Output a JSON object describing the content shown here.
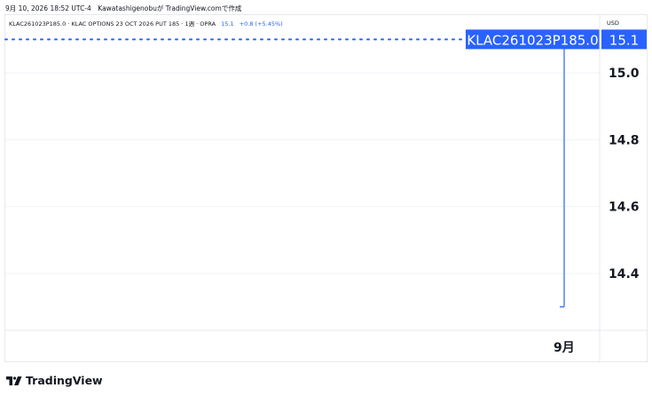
{
  "caption": "9月 10, 2026 18:52 UTC-4　Kawatashigenobuが TradingView.comで作成",
  "legend": {
    "title": "KLAC261023P185.0 · KLAC OPTIONS 23 OCT 2026 PUT 185 · 1週 · OPRA",
    "value": "15.1",
    "change": "+0.8 (+5.45%)"
  },
  "currency": "USD",
  "brand": {
    "name": "TradingView",
    "icon": "tradingview-logo-icon"
  },
  "colors": {
    "line": "#2962ff",
    "grid": "#f0f3fa",
    "axis_text": "#131722"
  },
  "chart_data": {
    "type": "line",
    "series": [
      {
        "name": "KLAC261023P185.0",
        "points": [
          {
            "x": "9月",
            "y": 14.3
          },
          {
            "x": "9月",
            "y": 15.1
          }
        ]
      }
    ],
    "last_value": 15.1,
    "last_value_label": "15.1",
    "series_label": "KLAC261023P185.0",
    "x_ticks": [
      "9月"
    ],
    "y_ticks": [
      {
        "value": 15.0,
        "label": "15.0"
      },
      {
        "value": 14.8,
        "label": "14.8"
      },
      {
        "value": 14.6,
        "label": "14.6"
      },
      {
        "value": 14.4,
        "label": "14.4"
      }
    ],
    "ylim": [
      14.25,
      15.2
    ],
    "grid": true,
    "legend_position": "top-left"
  }
}
